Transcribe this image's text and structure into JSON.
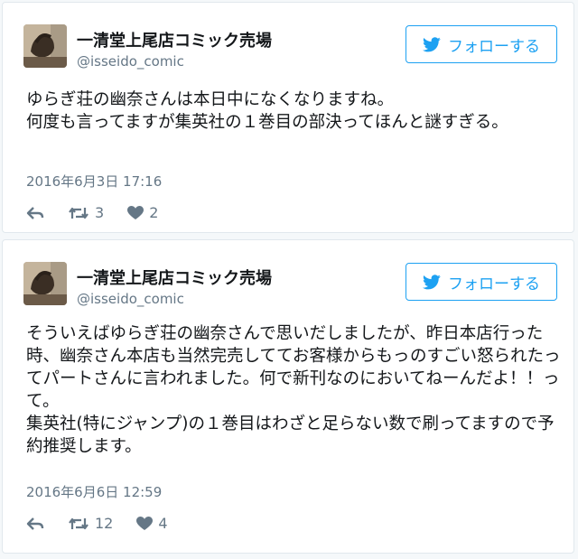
{
  "tweets": [
    {
      "name": "一清堂上尾店コミック売場",
      "handle": "@isseido_comic",
      "follow_label": "フォローする",
      "text": "ゆらぎ荘の幽奈さんは本日中になくなりますね。\n何度も言ってますが集英社の１巻目の部決ってほんと謎すぎる。",
      "date": "2016年6月3日 17:16",
      "retweets": "3",
      "likes": "2"
    },
    {
      "name": "一清堂上尾店コミック売場",
      "handle": "@isseido_comic",
      "follow_label": "フォローする",
      "text": "そういえばゆらぎ荘の幽奈さんで思いだしましたが、昨日本店行った時、幽奈さん本店も当然完売しててお客様からもっのすごい怒られたってパートさんに言われました。何で新刊なのにおいてねーんだよ！！って。\n集英社(特にジャンプ)の１巻目はわざと足らない数で刷ってますので予約推奨します。",
      "date": "2016年6月6日 12:59",
      "retweets": "12",
      "likes": "4"
    }
  ],
  "colors": {
    "accent": "#1da1f2",
    "muted": "#657786",
    "text": "#14171a",
    "border": "#e1e8ed"
  },
  "icons": [
    "avatar",
    "twitter-bird-icon",
    "reply-icon",
    "retweet-icon",
    "heart-icon"
  ]
}
